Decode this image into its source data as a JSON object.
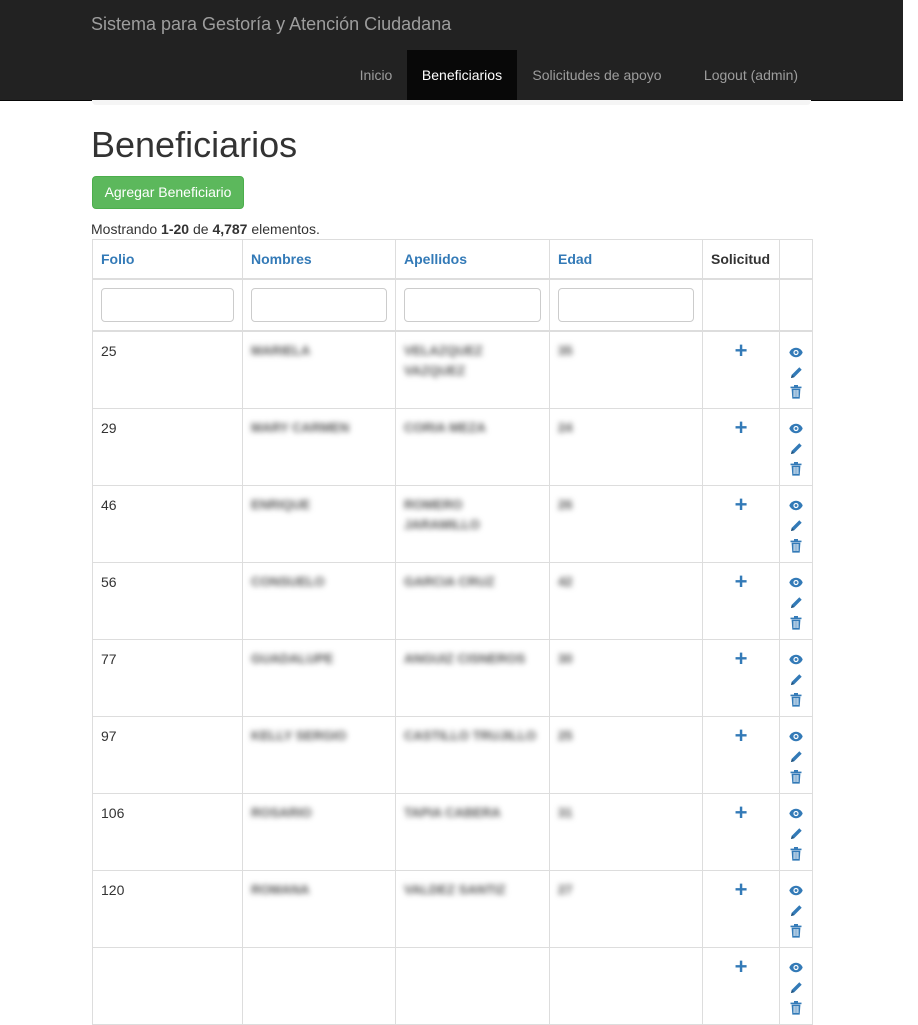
{
  "app": {
    "brand": "Sistema para Gestoría y Atención Ciudadana",
    "nav": [
      {
        "label": "Inicio",
        "active": false
      },
      {
        "label": "Beneficiarios",
        "active": true
      },
      {
        "label": "Solicitudes de apoyo",
        "active": false
      },
      {
        "label": "Logout (admin)",
        "active": false
      }
    ]
  },
  "page": {
    "title": "Beneficiarios",
    "add_button": "Agregar Beneficiario",
    "summary": {
      "prefix": "Mostrando",
      "range": "1-20",
      "of": "de",
      "total": "4,787",
      "suffix": "elementos."
    }
  },
  "table": {
    "columns": [
      "Folio",
      "Nombres",
      "Apellidos",
      "Edad",
      "Solicitud",
      ""
    ],
    "rows": [
      {
        "folio": "25",
        "nombres": "MARIELA",
        "apellidos": "VELAZQUEZ VAZQUEZ",
        "edad": "35"
      },
      {
        "folio": "29",
        "nombres": "MARY CARMEN",
        "apellidos": "CORIA MEZA",
        "edad": "24"
      },
      {
        "folio": "46",
        "nombres": "ENRIQUE",
        "apellidos": "ROMERO JARAMILLO",
        "edad": "26"
      },
      {
        "folio": "56",
        "nombres": "CONSUELO",
        "apellidos": "GARCIA CRUZ",
        "edad": "42"
      },
      {
        "folio": "77",
        "nombres": "GUADALUPE",
        "apellidos": "ANGUIZ CISNEROS",
        "edad": "30"
      },
      {
        "folio": "97",
        "nombres": "KELLY SERGIO",
        "apellidos": "CASTILLO TRUJILLO",
        "edad": "25"
      },
      {
        "folio": "106",
        "nombres": "ROSARIO",
        "apellidos": "TAPIA CABERA",
        "edad": "31"
      },
      {
        "folio": "120",
        "nombres": "ROMANA",
        "apellidos": "VALDEZ SANTIZ",
        "edad": "27"
      },
      {
        "folio": "",
        "nombres": "",
        "apellidos": "",
        "edad": ""
      }
    ]
  },
  "colors": {
    "navbar": "#222222",
    "link": "#337ab7",
    "success": "#5cb85c"
  },
  "icons": {
    "solicitud": "plus-icon",
    "view": "eye-icon",
    "edit": "pencil-icon",
    "delete": "trash-icon"
  }
}
